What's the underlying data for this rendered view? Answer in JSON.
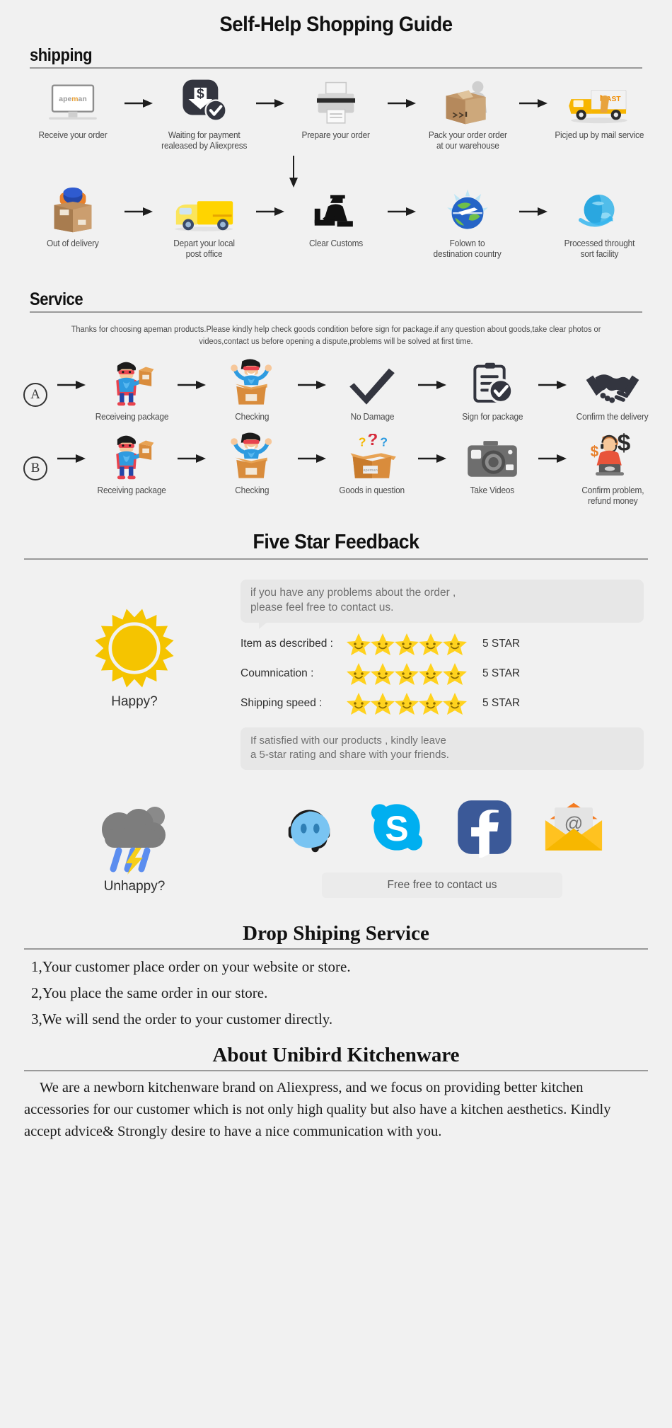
{
  "page": {
    "title": "Self-Help Shopping Guide",
    "background": "#f1f1f1"
  },
  "shipping": {
    "heading": "shipping",
    "row1": [
      {
        "caption": "Receive your order",
        "icon": "monitor-apeman-icon"
      },
      {
        "caption": "Waiting for payment\nrealeased by Aliexpress",
        "icon": "payment-dollar-icon"
      },
      {
        "caption": "Prepare your order",
        "icon": "printer-icon"
      },
      {
        "caption": "Pack your order order\nat our warehouse",
        "icon": "packing-box-icon"
      },
      {
        "caption": "Picjed up by mail service",
        "icon": "fast-truck-icon"
      }
    ],
    "row2": [
      {
        "caption": "Out of delivery",
        "icon": "courier-box-icon"
      },
      {
        "caption": "Depart your local\npost office",
        "icon": "yellow-van-icon"
      },
      {
        "caption": "Clear Customs",
        "icon": "customs-officer-icon"
      },
      {
        "caption": "Folown to\ndestination country",
        "icon": "globe-plane-icon"
      },
      {
        "caption": "Processed throught\nsort facility",
        "icon": "globe-sort-icon"
      }
    ]
  },
  "service": {
    "heading": "Service",
    "blurb": "Thanks for choosing apeman products.Please kindly help check goods condition before sign for package.if any question about goods,take clear photos or videos,contact us before opening a dispute,problems will be solved at first time.",
    "rowA": {
      "marker": "A",
      "steps": [
        {
          "caption": "Receiveing package",
          "icon": "hero-with-box-icon"
        },
        {
          "caption": "Checking",
          "icon": "hero-in-box-icon"
        },
        {
          "caption": "No Damage",
          "icon": "checkmark-icon"
        },
        {
          "caption": "Sign for package",
          "icon": "clipboard-check-icon"
        },
        {
          "caption": "Confirm the delivery",
          "icon": "handshake-icon"
        }
      ]
    },
    "rowB": {
      "marker": "B",
      "steps": [
        {
          "caption": "Receiving package",
          "icon": "hero-with-box-icon"
        },
        {
          "caption": "Checking",
          "icon": "hero-in-box-icon"
        },
        {
          "caption": "Goods in question",
          "icon": "question-box-icon"
        },
        {
          "caption": "Take Videos",
          "icon": "camera-icon"
        },
        {
          "caption": "Confirm problem,\nrefund money",
          "icon": "support-agent-dollar-icon"
        }
      ]
    }
  },
  "feedback": {
    "heading": "Five Star Feedback",
    "bubble_top": "if you have any problems about the order ,\nplease feel free to contact us.",
    "happy_label": "Happy?",
    "ratings": [
      {
        "label": "Item as described :",
        "stars": 5,
        "value": "5 STAR"
      },
      {
        "label": "Coumnication :",
        "stars": 5,
        "value": "5 STAR"
      },
      {
        "label": "Shipping speed :",
        "stars": 5,
        "value": "5 STAR"
      }
    ],
    "bubble_bottom": "If satisfied with our products ,  kindly leave\na 5-star rating and share with your friends.",
    "unhappy_label": "Unhappy?",
    "contact_icons": [
      "trademanager-headset-icon",
      "skype-icon",
      "facebook-icon",
      "email-envelope-icon"
    ],
    "contact_bar": "Free free to contact us",
    "star_color": "#FFD21E",
    "sun_color": "#F5C400",
    "skype_color": "#00AFF0",
    "facebook_color": "#3B5998",
    "envelope_color": "#FFC220"
  },
  "dropship": {
    "heading": "Drop Shiping Service",
    "lines": [
      "1,Your customer place order on your website or store.",
      "2,You place the same order in our store.",
      "3,We will send the order to your customer directly."
    ]
  },
  "about": {
    "heading": "About Unibird Kitchenware",
    "body": "We are a newborn kitchenware brand on Aliexpress, and we focus on providing better kitchen accessories for our customer which is not only high quality but also have a kitchen aesthetics. Kindly accept advice& Strongly desire to have a nice communication with you."
  }
}
